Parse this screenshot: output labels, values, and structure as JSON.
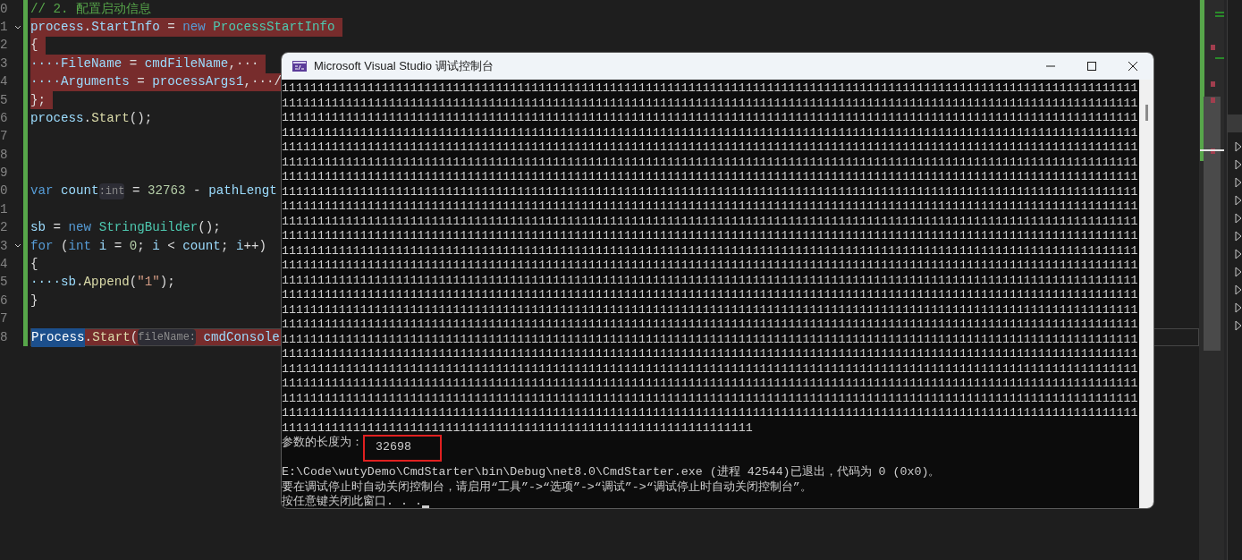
{
  "editor": {
    "lines": [
      {
        "number": "0",
        "fold": false,
        "highlighted": false,
        "current": false,
        "segments": [
          {
            "text": "// 2. 配置启动信息",
            "kind": "comment"
          }
        ]
      },
      {
        "number": "1",
        "fold": true,
        "highlighted": true,
        "current": false,
        "segments": [
          {
            "text": "process",
            "kind": "var"
          },
          {
            "text": ".",
            "kind": "plain"
          },
          {
            "text": "StartInfo",
            "kind": "var"
          },
          {
            "text": " = ",
            "kind": "plain"
          },
          {
            "text": "new",
            "kind": "keyword"
          },
          {
            "text": " ProcessStartInfo",
            "kind": "type"
          }
        ]
      },
      {
        "number": "2",
        "fold": false,
        "highlighted": true,
        "current": false,
        "segments": [
          {
            "text": "{",
            "kind": "plain"
          }
        ]
      },
      {
        "number": "3",
        "fold": false,
        "highlighted": true,
        "current": false,
        "segments": [
          {
            "text": "····FileName",
            "kind": "var"
          },
          {
            "text": " = ",
            "kind": "plain"
          },
          {
            "text": "cmdFileName",
            "kind": "var"
          },
          {
            "text": ",···",
            "kind": "plain"
          }
        ]
      },
      {
        "number": "4",
        "fold": false,
        "highlighted": true,
        "current": false,
        "segments": [
          {
            "text": "····Arguments",
            "kind": "var"
          },
          {
            "text": " = ",
            "kind": "plain"
          },
          {
            "text": "processArgs1",
            "kind": "var"
          },
          {
            "text": ",···/",
            "kind": "plain"
          }
        ]
      },
      {
        "number": "5",
        "fold": false,
        "highlighted": true,
        "current": false,
        "segments": [
          {
            "text": "};",
            "kind": "plain"
          }
        ]
      },
      {
        "number": "6",
        "fold": false,
        "highlighted": false,
        "current": false,
        "segments": [
          {
            "text": "process",
            "kind": "var"
          },
          {
            "text": ".",
            "kind": "plain"
          },
          {
            "text": "Start",
            "kind": "method"
          },
          {
            "text": "();",
            "kind": "plain"
          }
        ]
      },
      {
        "number": "7",
        "fold": false,
        "highlighted": false,
        "current": false
      },
      {
        "number": "8",
        "fold": false,
        "highlighted": false,
        "current": false
      },
      {
        "number": "9",
        "fold": false,
        "highlighted": false,
        "current": false
      },
      {
        "number": "0",
        "fold": false,
        "highlighted": false,
        "current": false,
        "segments": [
          {
            "text": "var",
            "kind": "keyword"
          },
          {
            "text": " count",
            "kind": "var"
          },
          {
            "text": ":int",
            "kind": "hint"
          },
          {
            "text": " = ",
            "kind": "plain"
          },
          {
            "text": "32763",
            "kind": "number"
          },
          {
            "text": " - ",
            "kind": "plain"
          },
          {
            "text": "pathLengt",
            "kind": "var"
          }
        ]
      },
      {
        "number": "1",
        "fold": false,
        "highlighted": false,
        "current": false
      },
      {
        "number": "2",
        "fold": false,
        "highlighted": false,
        "current": false,
        "segments": [
          {
            "text": "sb",
            "kind": "var"
          },
          {
            "text": " = ",
            "kind": "plain"
          },
          {
            "text": "new",
            "kind": "keyword"
          },
          {
            "text": " StringBuilder",
            "kind": "type"
          },
          {
            "text": "();",
            "kind": "plain"
          }
        ]
      },
      {
        "number": "3",
        "fold": true,
        "highlighted": false,
        "current": false,
        "segments": [
          {
            "text": "for",
            "kind": "keyword"
          },
          {
            "text": " (",
            "kind": "plain"
          },
          {
            "text": "int",
            "kind": "keyword"
          },
          {
            "text": " i",
            "kind": "var"
          },
          {
            "text": " = ",
            "kind": "plain"
          },
          {
            "text": "0",
            "kind": "number"
          },
          {
            "text": "; ",
            "kind": "plain"
          },
          {
            "text": "i",
            "kind": "var"
          },
          {
            "text": " < ",
            "kind": "plain"
          },
          {
            "text": "count",
            "kind": "var"
          },
          {
            "text": "; ",
            "kind": "plain"
          },
          {
            "text": "i",
            "kind": "var"
          },
          {
            "text": "++)",
            "kind": "plain"
          }
        ]
      },
      {
        "number": "4",
        "fold": false,
        "highlighted": false,
        "current": false,
        "segments": [
          {
            "text": "{",
            "kind": "plain"
          }
        ]
      },
      {
        "number": "5",
        "fold": false,
        "highlighted": false,
        "current": false,
        "segments": [
          {
            "text": "····sb",
            "kind": "var"
          },
          {
            "text": ".",
            "kind": "plain"
          },
          {
            "text": "Append",
            "kind": "method"
          },
          {
            "text": "(",
            "kind": "plain"
          },
          {
            "text": "\"1\"",
            "kind": "string"
          },
          {
            "text": ");",
            "kind": "plain"
          }
        ]
      },
      {
        "number": "6",
        "fold": false,
        "highlighted": false,
        "current": false,
        "segments": [
          {
            "text": "}",
            "kind": "plain"
          }
        ]
      },
      {
        "number": "7",
        "fold": false,
        "highlighted": false,
        "current": false
      },
      {
        "number": "8",
        "fold": false,
        "highlighted": true,
        "current": true,
        "segments": [
          {
            "text": "Process",
            "kind": "selected"
          },
          {
            "text": ".",
            "kind": "plain"
          },
          {
            "text": "Start",
            "kind": "method"
          },
          {
            "text": "(",
            "kind": "plain"
          },
          {
            "text": "fileName:",
            "kind": "hint"
          },
          {
            "text": " cmdConsole",
            "kind": "var"
          }
        ]
      }
    ]
  },
  "console": {
    "title": "Microsoft Visual Studio 调试控制台",
    "output_lines": [
      "111111111111111111111111111111111111111111111111111111111111111111111111111111111111111111111111111111111111111111111111",
      "111111111111111111111111111111111111111111111111111111111111111111111111111111111111111111111111111111111111111111111111",
      "111111111111111111111111111111111111111111111111111111111111111111111111111111111111111111111111111111111111111111111111",
      "111111111111111111111111111111111111111111111111111111111111111111111111111111111111111111111111111111111111111111111111",
      "111111111111111111111111111111111111111111111111111111111111111111111111111111111111111111111111111111111111111111111111",
      "111111111111111111111111111111111111111111111111111111111111111111111111111111111111111111111111111111111111111111111111",
      "111111111111111111111111111111111111111111111111111111111111111111111111111111111111111111111111111111111111111111111111",
      "111111111111111111111111111111111111111111111111111111111111111111111111111111111111111111111111111111111111111111111111",
      "111111111111111111111111111111111111111111111111111111111111111111111111111111111111111111111111111111111111111111111111",
      "111111111111111111111111111111111111111111111111111111111111111111111111111111111111111111111111111111111111111111111111",
      "111111111111111111111111111111111111111111111111111111111111111111111111111111111111111111111111111111111111111111111111",
      "111111111111111111111111111111111111111111111111111111111111111111111111111111111111111111111111111111111111111111111111",
      "111111111111111111111111111111111111111111111111111111111111111111111111111111111111111111111111111111111111111111111111",
      "111111111111111111111111111111111111111111111111111111111111111111111111111111111111111111111111111111111111111111111111",
      "111111111111111111111111111111111111111111111111111111111111111111111111111111111111111111111111111111111111111111111111",
      "111111111111111111111111111111111111111111111111111111111111111111111111111111111111111111111111111111111111111111111111",
      "111111111111111111111111111111111111111111111111111111111111111111111111111111111111111111111111111111111111111111111111",
      "111111111111111111111111111111111111111111111111111111111111111111111111111111111111111111111111111111111111111111111111",
      "111111111111111111111111111111111111111111111111111111111111111111111111111111111111111111111111111111111111111111111111",
      "111111111111111111111111111111111111111111111111111111111111111111111111111111111111111111111111111111111111111111111111",
      "111111111111111111111111111111111111111111111111111111111111111111111111111111111111111111111111111111111111111111111111",
      "111111111111111111111111111111111111111111111111111111111111111111111111111111111111111111111111111111111111111111111111",
      "111111111111111111111111111111111111111111111111111111111111111111111111111111111111111111111111111111111111111111111111",
      "111111111111111111111111111111111111111111111111111111111111111111"
    ],
    "length_label": "参数的长度为：",
    "length_value": "32698",
    "exit_message": "E:\\Code\\wutyDemo\\CmdStarter\\bin\\Debug\\net8.0\\CmdStarter.exe (进程 42544)已退出，代码为 0 (0x0)。",
    "hint_message": "要在调试停止时自动关闭控制台，请启用“工具”->“选项”->“调试”->“调试停止时自动关闭控制台”。",
    "prompt": "按任意键关闭此窗口. . ."
  }
}
